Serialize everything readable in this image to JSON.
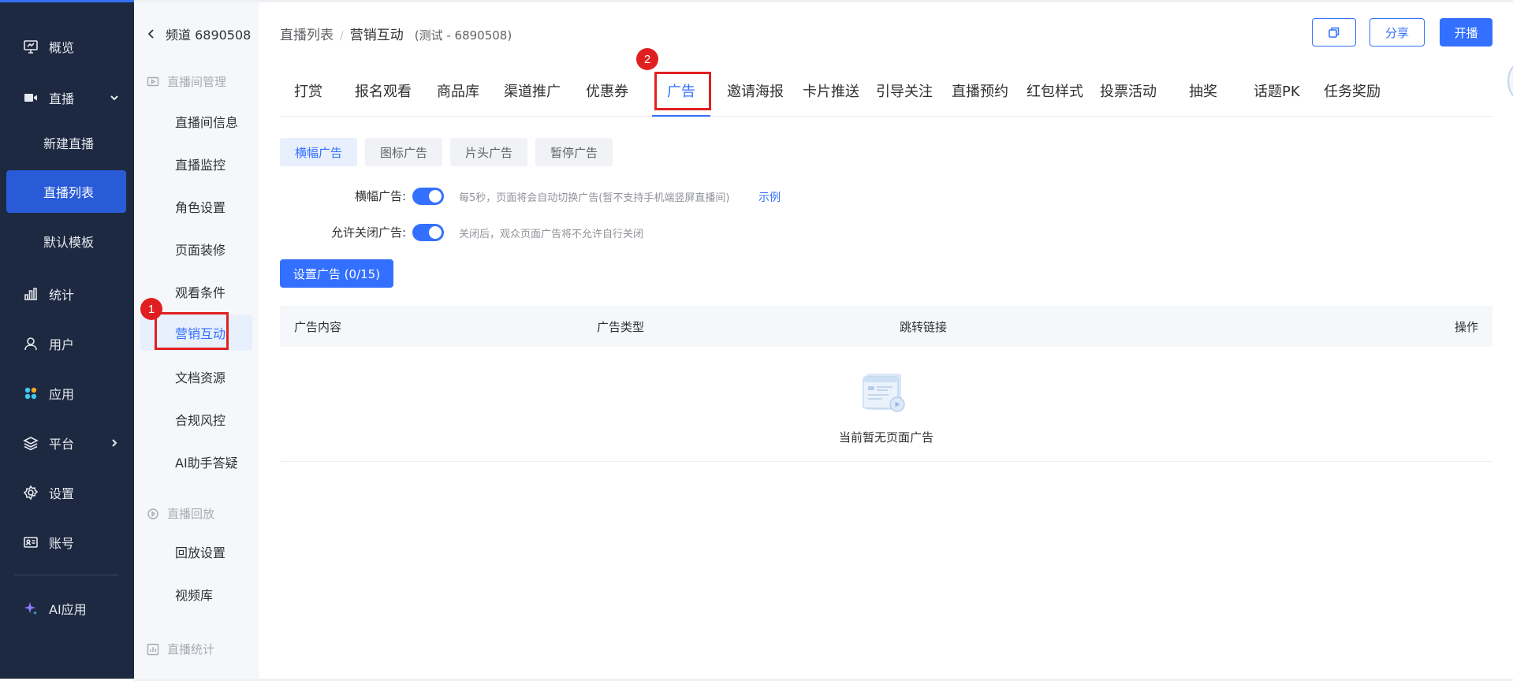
{
  "sidebar": {
    "items": [
      {
        "label": "概览",
        "icon": "monitor-icon"
      },
      {
        "label": "直播",
        "icon": "video-icon"
      },
      {
        "label": "统计",
        "icon": "bar-chart-icon"
      },
      {
        "label": "用户",
        "icon": "user-icon"
      },
      {
        "label": "应用",
        "icon": "apps-icon"
      },
      {
        "label": "平台",
        "icon": "layers-icon"
      },
      {
        "label": "设置",
        "icon": "gear-icon"
      },
      {
        "label": "账号",
        "icon": "id-card-icon"
      },
      {
        "label": "AI应用",
        "icon": "sparkle-icon"
      }
    ],
    "live_sub": [
      "新建直播",
      "直播列表",
      "默认模板"
    ]
  },
  "submenu": {
    "back_label": "频道 6890508",
    "group1": "直播间管理",
    "items1": [
      "直播间信息",
      "直播监控",
      "角色设置",
      "页面装修",
      "观看条件",
      "营销互动",
      "文档资源",
      "合规风控",
      "AI助手答疑"
    ],
    "group2": "直播回放",
    "items2": [
      "回放设置",
      "视频库"
    ],
    "group3": "直播统计"
  },
  "breadcrumb": {
    "link": "直播列表",
    "current": "营销互动",
    "sub": "(测试 - 6890508)"
  },
  "header_buttons": {
    "share": "分享",
    "start": "开播"
  },
  "tabs": [
    "打赏",
    "报名观看",
    "商品库",
    "渠道推广",
    "优惠券",
    "广告",
    "邀请海报",
    "卡片推送",
    "引导关注",
    "直播预约",
    "红包样式",
    "投票活动",
    "抽奖",
    "话题PK",
    "任务奖励"
  ],
  "ad_types": [
    "横幅广告",
    "图标广告",
    "片头广告",
    "暂停广告"
  ],
  "settings": {
    "banner_label": "横幅广告:",
    "banner_hint": "每5秒，页面将会自动切换广告(暂不支持手机端竖屏直播间)",
    "example_link": "示例",
    "allow_close_label": "允许关闭广告:",
    "allow_close_hint": "关闭后，观众页面广告将不允许自行关闭",
    "banner_enabled": true,
    "allow_close_enabled": true
  },
  "set_ad_button": "设置广告 (0/15)",
  "table": {
    "headers": [
      "广告内容",
      "广告类型",
      "跳转链接",
      "操作"
    ],
    "empty_text": "当前暂无页面广告"
  },
  "annotations": [
    "1",
    "2"
  ],
  "colors": {
    "accent": "#3370ff",
    "sidebar": "#1c2940",
    "annotation": "#e02020"
  }
}
